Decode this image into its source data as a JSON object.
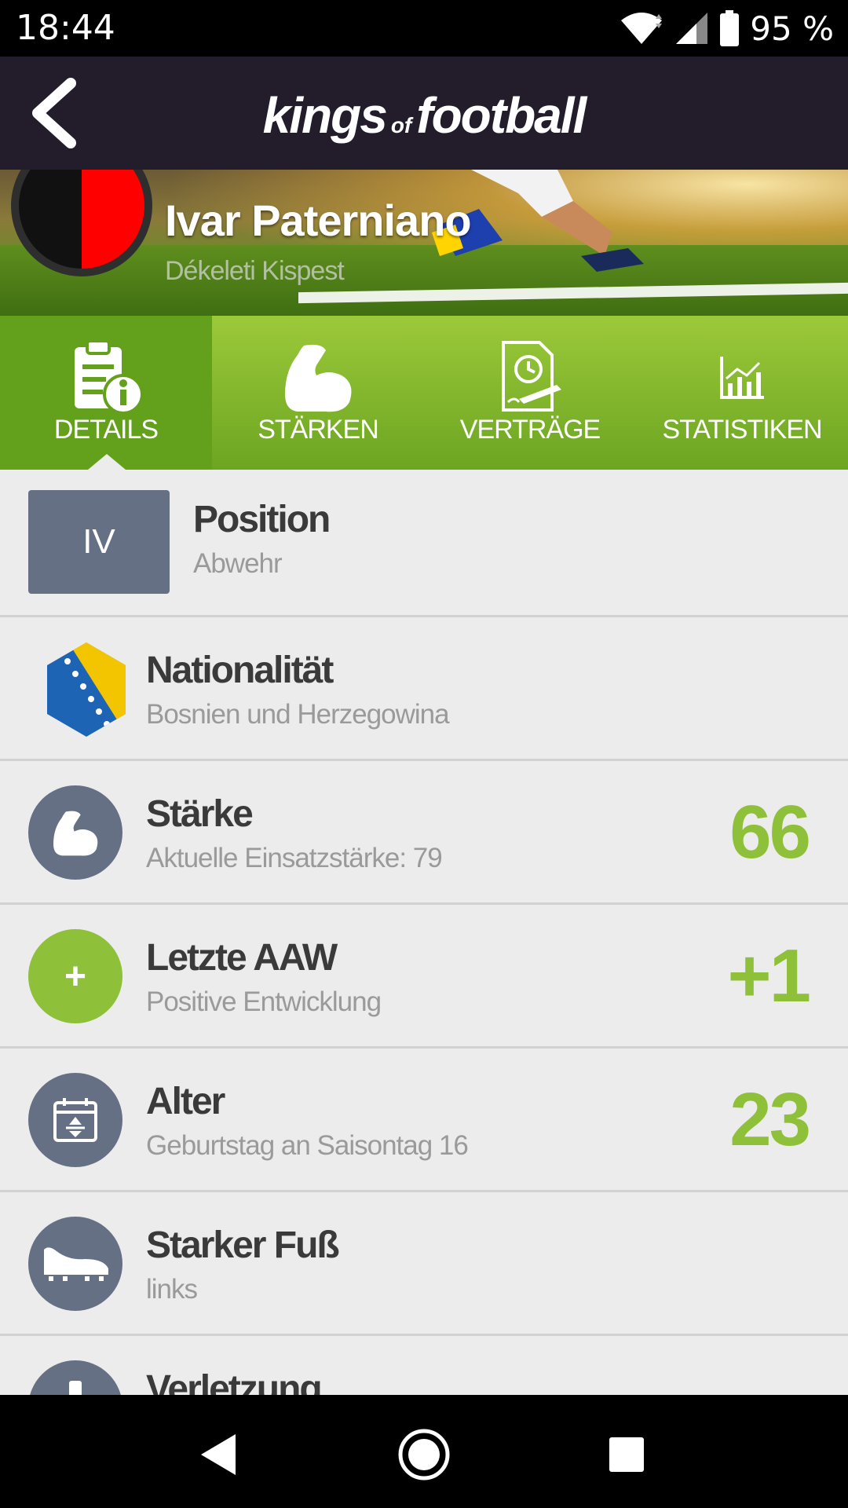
{
  "status_bar": {
    "time": "18:44",
    "battery": "95 %"
  },
  "header": {
    "logo_part1": "kings",
    "logo_part2": "of",
    "logo_part3": "football"
  },
  "player": {
    "name": "Ivar Paterniano",
    "club": "Dékeleti Kispest"
  },
  "tabs": [
    {
      "label": "DETAILS",
      "icon": "clipboard-info-icon",
      "active": true
    },
    {
      "label": "STÄRKEN",
      "icon": "muscle-icon",
      "active": false
    },
    {
      "label": "VERTRÄGE",
      "icon": "contract-icon",
      "active": false
    },
    {
      "label": "STATISTIKEN",
      "icon": "chart-icon",
      "active": false
    }
  ],
  "rows": {
    "position": {
      "badge": "IV",
      "title": "Position",
      "subtitle": "Abwehr"
    },
    "nationality": {
      "title": "Nationalität",
      "subtitle": "Bosnien und Herzegowina",
      "icon": "bosnia-flag-icon"
    },
    "strength": {
      "title": "Stärke",
      "subtitle": "Aktuelle Einsatzstärke: 79",
      "value": "66",
      "icon": "muscle-icon"
    },
    "last_aaw": {
      "title": "Letzte AAW",
      "subtitle": "Positive Entwicklung",
      "value": "+1",
      "icon_text": "+"
    },
    "age": {
      "title": "Alter",
      "subtitle": "Geburtstag an Saisontag 16",
      "value": "23",
      "icon": "calendar-icon"
    },
    "foot": {
      "title": "Starker Fuß",
      "subtitle": "links",
      "icon": "boot-icon"
    },
    "injury": {
      "title": "Verletzung",
      "icon": "exclamation-icon"
    }
  },
  "colors": {
    "accent_green": "#8ec03a",
    "header_bg": "#221c2b",
    "icon_gray": "#667085"
  }
}
